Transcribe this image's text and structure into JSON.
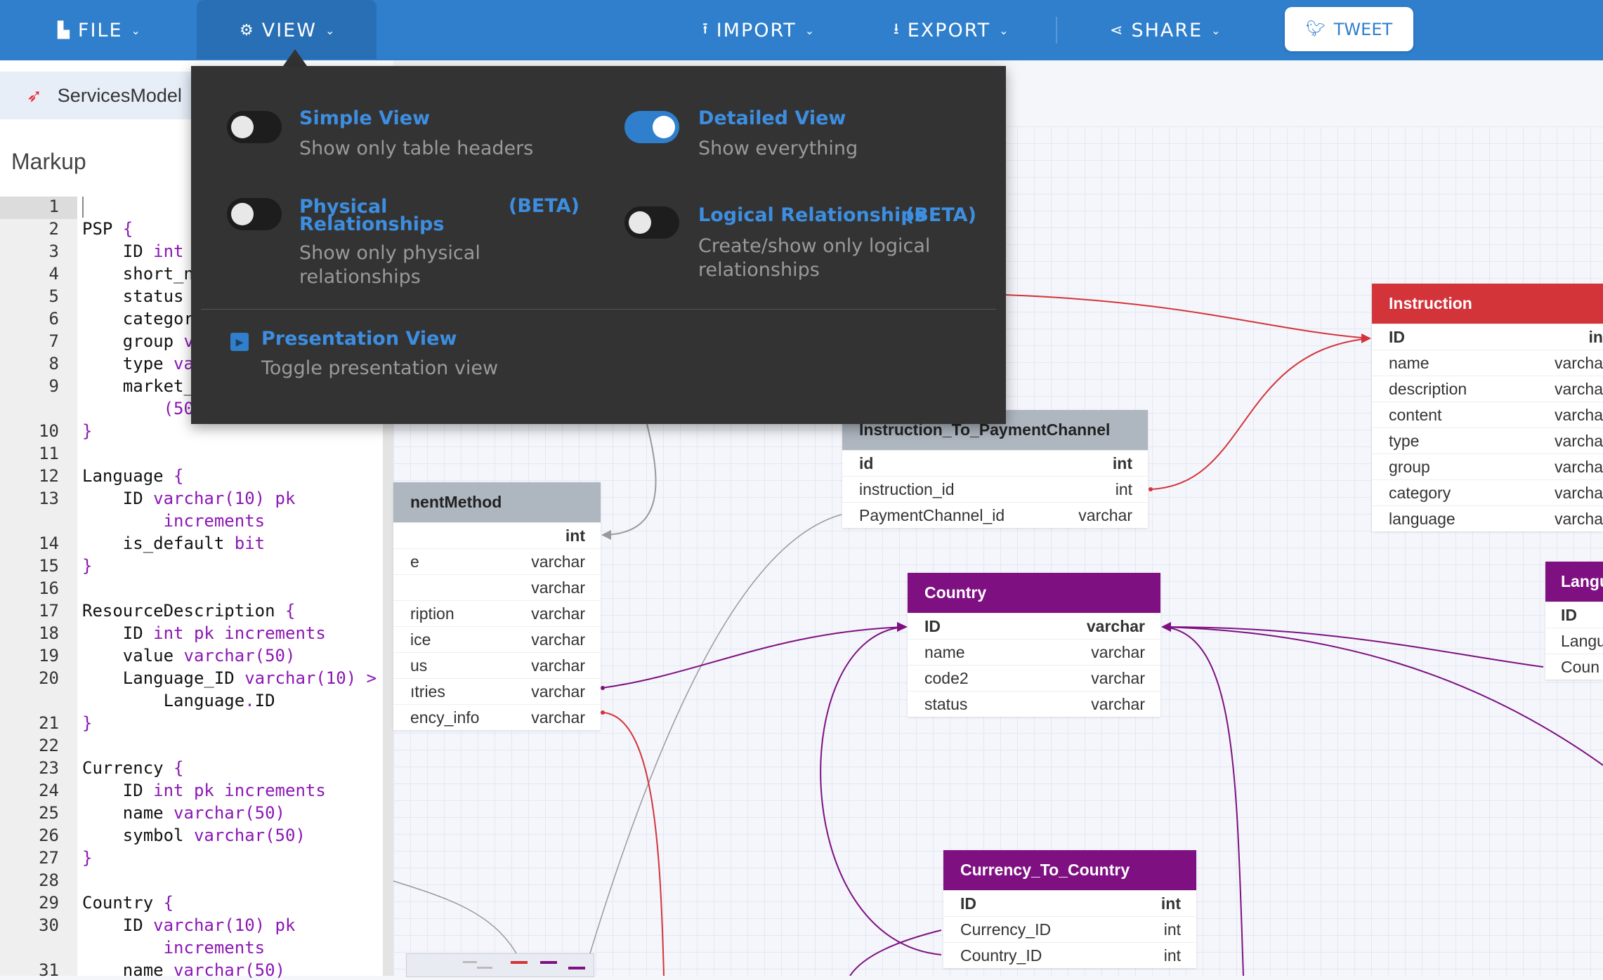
{
  "topbar": {
    "file": "FILE",
    "view": "VIEW",
    "import": "IMPORT",
    "export": "EXPORT",
    "share": "SHARE",
    "tweet": "TWEET"
  },
  "file_tab": {
    "name": "ServicesModel"
  },
  "markup": {
    "title": "Markup",
    "line_numbers": [
      "1",
      "2",
      "3",
      "4",
      "5",
      "6",
      "7",
      "8",
      "9",
      "10",
      "11",
      "12",
      "13",
      "14",
      "15",
      "16",
      "17",
      "18",
      "19",
      "20",
      "21",
      "22",
      "23",
      "24",
      "25",
      "26",
      "27",
      "28",
      "29",
      "30",
      "31"
    ],
    "psp": {
      "name": "PSP",
      "open": "{",
      "id": "ID",
      "id_type": "int",
      "short": "short_n",
      "status": "status",
      "category": "categor",
      "group": "group",
      "group_type": "v",
      "type": "type",
      "type_type": "va",
      "market": "market_",
      "market_type": "(50",
      "close": "}"
    },
    "language": {
      "name": "Language",
      "open": "{",
      "id": "ID",
      "id_type": "varchar(10) pk",
      "id_cont": "increments",
      "default": "is_default",
      "default_type": "bit",
      "close": "}"
    },
    "resource": {
      "name": "ResourceDescription",
      "open": "{",
      "id": "ID",
      "id_type": "int pk increments",
      "value": "value",
      "value_type": "varchar(50)",
      "lang": "Language_ID",
      "lang_type": "varchar(10) >",
      "lang_ref": "Language",
      "lang_dot": ".",
      "lang_ref_field": "ID",
      "close": "}"
    },
    "currency": {
      "name": "Currency",
      "open": "{",
      "id": "ID",
      "id_type": "int pk increments",
      "name_f": "name",
      "name_type": "varchar(50)",
      "symbol": "symbol",
      "symbol_type": "varchar(50)",
      "close": "}"
    },
    "country": {
      "name": "Country",
      "open": "{",
      "id": "ID",
      "id_type": "varchar(10) pk",
      "id_cont": "increments",
      "name_f": "name",
      "name_type": "varchar(50)"
    }
  },
  "view_menu": {
    "simple_title": "Simple View",
    "simple_desc": "Show only table headers",
    "detailed_title": "Detailed View",
    "detailed_desc": "Show everything",
    "physical_title_1": "Physical",
    "physical_title_2": "Relationships",
    "physical_beta": "(BETA)",
    "physical_desc_1": "Show only physical",
    "physical_desc_2": "relationships",
    "logical_title": "Logical Relationships",
    "logical_beta": "(BETA)",
    "logical_desc_1": "Create/show only logical",
    "logical_desc_2": "relationships",
    "presentation_title": "Presentation View",
    "presentation_desc": "Toggle presentation view",
    "simple_on": false,
    "detailed_on": true,
    "physical_on": false,
    "logical_on": false
  },
  "diagram": {
    "instruction": {
      "title": "Instruction",
      "rows": [
        {
          "name": "ID",
          "type": "in"
        },
        {
          "name": "name",
          "type": "varcha"
        },
        {
          "name": "description",
          "type": "varcha"
        },
        {
          "name": "content",
          "type": "varcha"
        },
        {
          "name": "type",
          "type": "varcha"
        },
        {
          "name": "group",
          "type": "varcha"
        },
        {
          "name": "category",
          "type": "varcha"
        },
        {
          "name": "language",
          "type": "varcha"
        }
      ]
    },
    "instruction_to_paymentchannel": {
      "title": "Instruction_To_PaymentChannel",
      "rows": [
        {
          "name": "id",
          "type": "int"
        },
        {
          "name": "instruction_id",
          "type": "int"
        },
        {
          "name": "PaymentChannel_id",
          "type": "varchar"
        }
      ]
    },
    "paymentmethod": {
      "title": "nentMethod",
      "rows": [
        {
          "name": "",
          "type": "int"
        },
        {
          "name": "e",
          "type": "varchar"
        },
        {
          "name": "",
          "type": "varchar"
        },
        {
          "name": "ription",
          "type": "varchar"
        },
        {
          "name": "ice",
          "type": "varchar"
        },
        {
          "name": "us",
          "type": "varchar"
        },
        {
          "name": "ıtries",
          "type": "varchar"
        },
        {
          "name": "ency_info",
          "type": "varchar"
        }
      ]
    },
    "country": {
      "title": "Country",
      "rows": [
        {
          "name": "ID",
          "type": "varchar"
        },
        {
          "name": "name",
          "type": "varchar"
        },
        {
          "name": "code2",
          "type": "varchar"
        },
        {
          "name": "status",
          "type": "varchar"
        }
      ]
    },
    "language": {
      "title": "Langu",
      "rows": [
        {
          "name": "ID",
          "type": ""
        },
        {
          "name": "Langu",
          "type": ""
        },
        {
          "name": "Coun",
          "type": ""
        }
      ]
    },
    "currency_to_country": {
      "title": "Currency_To_Country",
      "rows": [
        {
          "name": "ID",
          "type": "int"
        },
        {
          "name": "Currency_ID",
          "type": "int"
        },
        {
          "name": "Country_ID",
          "type": "int"
        }
      ]
    }
  },
  "colors": {
    "topbar": "#2f7fcc",
    "menu_bg": "#333333",
    "accent_blue": "#3d8ee0",
    "table_red": "#d3343a",
    "table_purple": "#7e1081",
    "table_gray": "#aeb6c0",
    "keyword": "#8b17b5"
  }
}
